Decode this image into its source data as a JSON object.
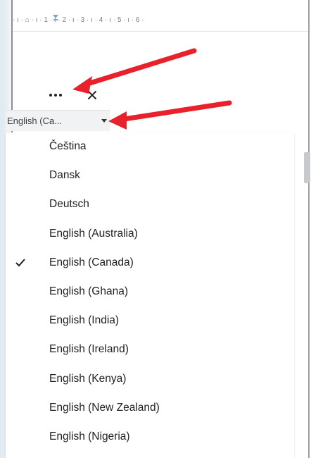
{
  "ruler": {
    "marks": "· ı · ⌂ · ı · 1 · ı · 2 · ı · 3 · ı · 4 · ı · 5 · ı · 6 ·"
  },
  "panel": {
    "more_icon": "more-options-icon",
    "close_icon": "close-icon",
    "close_label": "×"
  },
  "language_select": {
    "value": "English (Ca...",
    "icon": "dropdown-caret-icon"
  },
  "menu": {
    "items": [
      {
        "label": "Čeština",
        "checked": false
      },
      {
        "label": "Dansk",
        "checked": false
      },
      {
        "label": "Deutsch",
        "checked": false
      },
      {
        "label": "English (Australia)",
        "checked": false
      },
      {
        "label": "English (Canada)",
        "checked": true
      },
      {
        "label": "English (Ghana)",
        "checked": false
      },
      {
        "label": "English (India)",
        "checked": false
      },
      {
        "label": "English (Ireland)",
        "checked": false
      },
      {
        "label": "English (Kenya)",
        "checked": false
      },
      {
        "label": "English (New Zealand)",
        "checked": false
      },
      {
        "label": "English (Nigeria)",
        "checked": false
      }
    ]
  },
  "colors": {
    "annotation_arrow": "#e8212b",
    "checkmark": "#202124"
  }
}
